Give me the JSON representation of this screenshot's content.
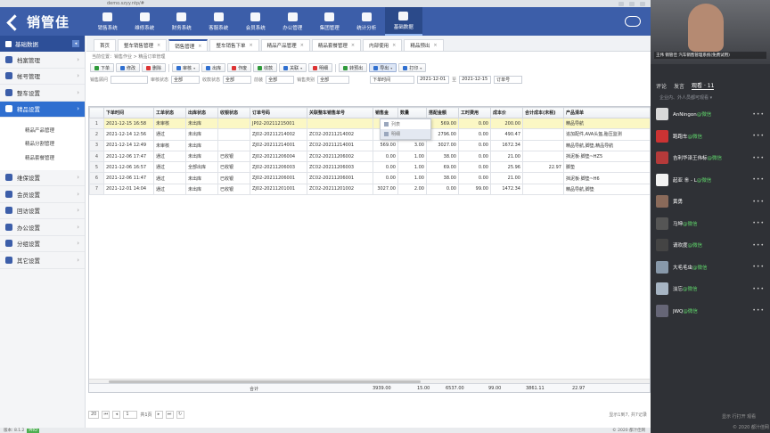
{
  "browser": {
    "url": "demo.szyy.ntp/#"
  },
  "app": {
    "logo_text": "销管佳",
    "nav": [
      {
        "label": "销售系统",
        "icon": "cart-icon"
      },
      {
        "label": "维修系统",
        "icon": "wrench-icon"
      },
      {
        "label": "财务系统",
        "icon": "money-bag-icon"
      },
      {
        "label": "客服系统",
        "icon": "headset-icon"
      },
      {
        "label": "会员系统",
        "icon": "users-icon"
      },
      {
        "label": "办公管理",
        "icon": "home-icon"
      },
      {
        "label": "集团管理",
        "icon": "org-chart-icon"
      },
      {
        "label": "统计分析",
        "icon": "bar-chart-icon"
      },
      {
        "label": "基础数据",
        "icon": "database-icon"
      }
    ],
    "nav_active": 8
  },
  "sidebar": {
    "header": "基础数据",
    "items": [
      {
        "label": "档案管理",
        "icon": "folder-icon"
      },
      {
        "label": "帐号管理",
        "icon": "account-icon"
      },
      {
        "label": "整车设置",
        "icon": "car-icon"
      },
      {
        "label": "精品设置",
        "icon": "gift-icon"
      }
    ],
    "subitems": [
      "精品产品管理",
      "精品分割管理",
      "精品套餐管理"
    ],
    "items2": [
      {
        "label": "维保设置",
        "icon": "wrench-icon"
      },
      {
        "label": "会员设置",
        "icon": "users-icon"
      },
      {
        "label": "回访设置",
        "icon": "phone-icon"
      },
      {
        "label": "办公设置",
        "icon": "office-icon"
      },
      {
        "label": "分组设置",
        "icon": "group-icon"
      },
      {
        "label": "其它设置",
        "icon": "settings-icon"
      }
    ]
  },
  "tabs": [
    "首页",
    "整车销售管理",
    "销售管理",
    "整车销售下单",
    "精品产品管理",
    "精品套餐管理",
    "内部使用",
    "精品预出"
  ],
  "breadcrumb": "当前位置：销售作业 > 精品订单管理",
  "toolbar": {
    "buttons": [
      "下单",
      "修改",
      "删除",
      "审核",
      "出库",
      "作废",
      "收款",
      "关联",
      "明细",
      "转预出",
      "导出",
      "打印"
    ],
    "dropdown_options": [
      "列表",
      "明细"
    ]
  },
  "filters": {
    "labels": [
      "销售顾问",
      "审核状态",
      "收款状态",
      "前装",
      "销售类别",
      "下单时间",
      "至"
    ],
    "values": [
      "全部",
      "全部",
      "全部",
      "全部"
    ],
    "date_from": "2021-12-01",
    "date_to": "2021-12-15",
    "order_no_label": "订单号"
  },
  "table": {
    "columns": [
      "下单时间",
      "工单状态",
      "出库状态",
      "收银状态",
      "订单号码",
      "关联整车销售单号",
      "销售金",
      "数量",
      "搭配金额",
      "工时费用",
      "成本价",
      "合计成本(未税)",
      "产品清单"
    ],
    "rows": [
      [
        "2021-12-15 16:58",
        "未审核",
        "未出库",
        "",
        "JP02-20211215001",
        "",
        "0.00",
        "1.00",
        "569.00",
        "0.00",
        "200.00",
        "",
        "精品导航"
      ],
      [
        "2021-12-14 12:56",
        "通过",
        "未出库",
        "",
        "ZJ02-20211214002",
        "ZC02-20211214002",
        "343.00",
        "6.00",
        "2796.00",
        "0.00",
        "490.47",
        "",
        "追加配件,AVA头盔,胎压监测"
      ],
      [
        "2021-12-14 12:49",
        "未审核",
        "未出库",
        "",
        "ZJ02-20211214001",
        "ZC02-20211214001",
        "569.00",
        "3.00",
        "3027.00",
        "0.00",
        "1672.34",
        "",
        "精品导航,脚垫,精品导航"
      ],
      [
        "2021-12-06 17:47",
        "通过",
        "未出库",
        "已收银",
        "ZJ02-20211206004",
        "ZC02-20211206002",
        "0.00",
        "1.00",
        "38.00",
        "0.00",
        "21.00",
        "",
        "挡泥板·脚垫~HZ5"
      ],
      [
        "2021-12-06 16:57",
        "通过",
        "全部出库",
        "已收银",
        "ZJ02-20211206003",
        "ZC02-20211206003",
        "0.00",
        "1.00",
        "69.00",
        "0.00",
        "25.96",
        "22.97",
        "脚垫"
      ],
      [
        "2021-12-06 11:47",
        "通过",
        "未出库",
        "已收银",
        "ZJ02-20211206001",
        "ZC02-20211206001",
        "0.00",
        "1.00",
        "38.00",
        "0.00",
        "21.00",
        "",
        "挡泥板·脚垫~H6"
      ],
      [
        "2021-12-01 14:04",
        "通过",
        "未出库",
        "已收银",
        "ZJ02-20211201001",
        "ZC02-20211201002",
        "3027.00",
        "2.00",
        "0.00",
        "99.00",
        "1472.34",
        "",
        "精品导航,脚垫"
      ]
    ],
    "totals": {
      "label": "合计",
      "sales": "3939.00",
      "qty": "15.00",
      "match": "6537.00",
      "labor": "99.00",
      "cost": "3861.11",
      "total_cost": "22.97"
    }
  },
  "pager": {
    "page_size": "20",
    "page": "1",
    "total_pages_text": "共1页",
    "info": "显示1到7, 共7记录"
  },
  "statusbar": {
    "version": "版本: 8.1.2",
    "badge": "PRO",
    "copyright": "© 2020 都汁佳网"
  },
  "live_panel": {
    "caption": "王伟 销管佳 汽车销售管理系统(免费试用)",
    "tabs": [
      "评论",
      "发言",
      "观看 · 11"
    ],
    "active_tab": 2,
    "tip": "企业内、外人员都可观看 ▾",
    "viewers": [
      {
        "name": "AnNingon",
        "wechat": "@微信",
        "color": "#d9d9d9"
      },
      {
        "name": "跑跑车",
        "wechat": "@微信",
        "color": "#cc3333"
      },
      {
        "name": "吉利华泽王伟标",
        "wechat": "@微信",
        "color": "#b53a3a"
      },
      {
        "name": "起亚 ㊎ - L",
        "wechat": "@微信",
        "color": "#f2f2f2"
      },
      {
        "name": "黄勇",
        "wechat": "",
        "color": "#8a6a5a"
      },
      {
        "name": "马坤",
        "wechat": "@微信",
        "color": "#555"
      },
      {
        "name": "请欢度",
        "wechat": "@微信",
        "color": "#444"
      },
      {
        "name": "大毛毛虫",
        "wechat": "@微信",
        "color": "#8899aa"
      },
      {
        "name": "淡忘",
        "wechat": "@微信",
        "color": "#a7b5c4"
      },
      {
        "name": "JWQ",
        "wechat": "@微信",
        "color": "#667"
      }
    ],
    "footer_a": "显示 行打开  观看",
    "footer_b": "© 2020 都汁佳网"
  }
}
